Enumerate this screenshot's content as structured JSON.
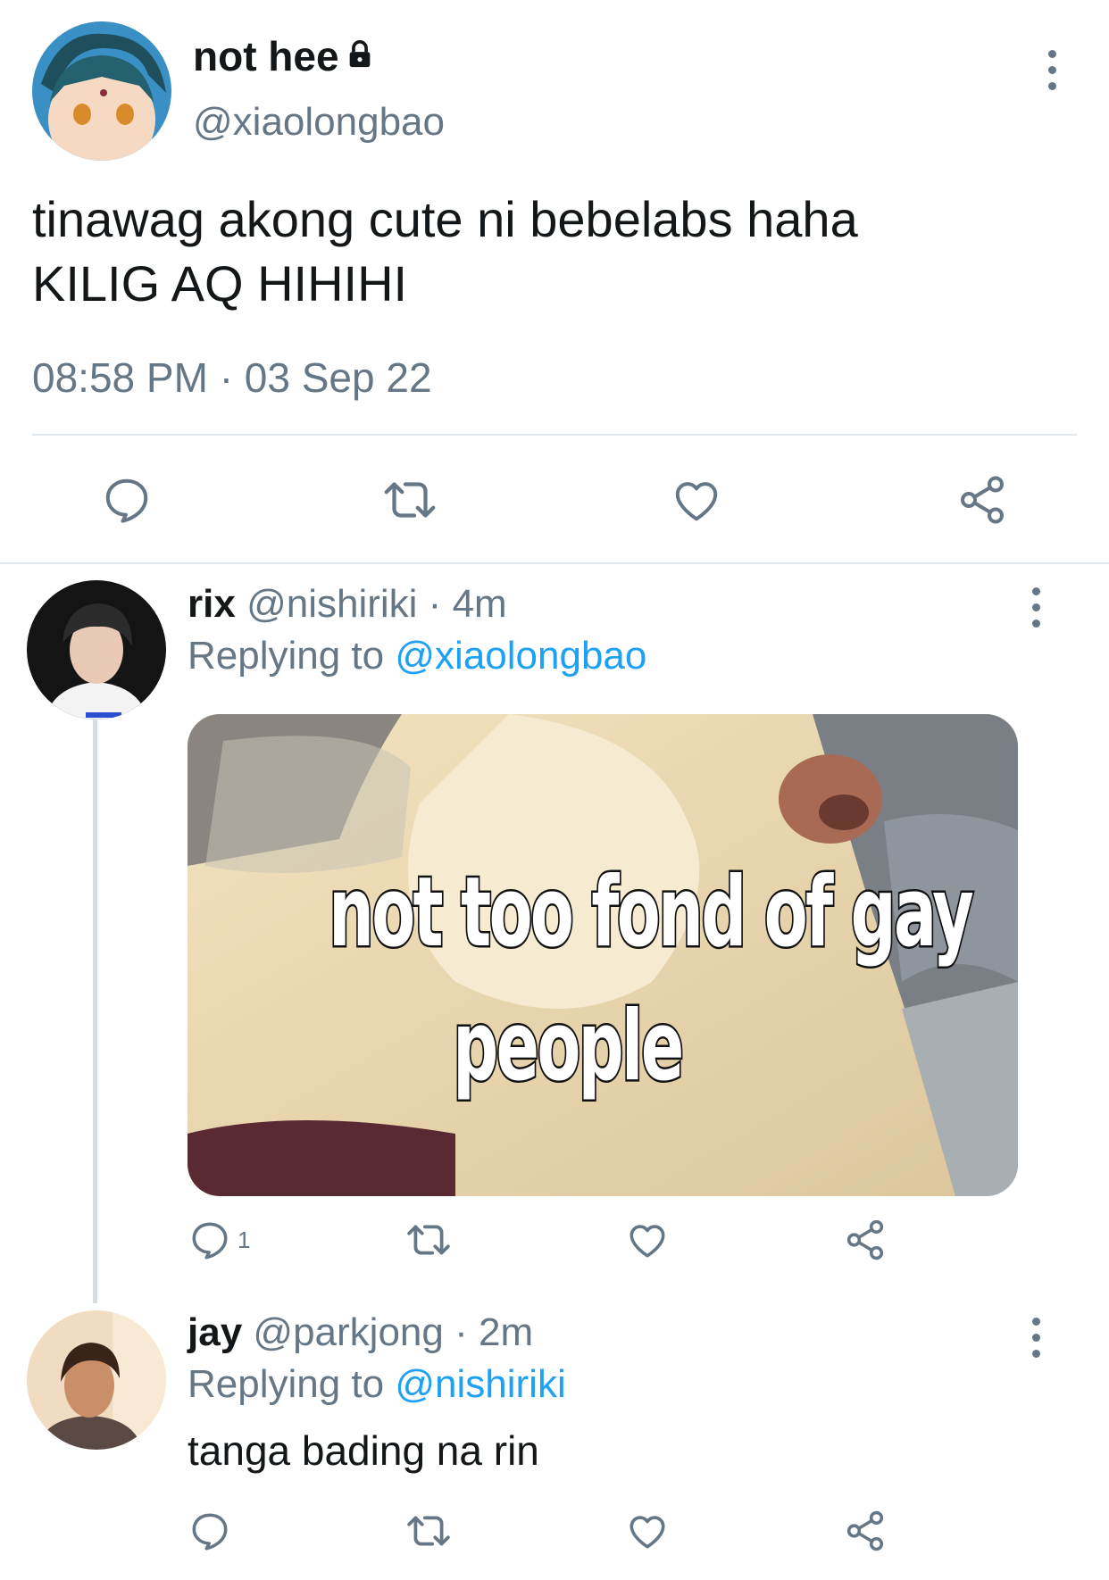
{
  "main_tweet": {
    "display_name": "not hee",
    "handle": "@xiaolongbao",
    "text_line1": "tinawag akong cute ni bebelabs haha",
    "text_line2": "KILIG AQ HIHIHI",
    "time": "08:58 PM",
    "separator": "·",
    "date": "03 Sep 22"
  },
  "reply1": {
    "display_name": "rix",
    "handle": "@nishiriki",
    "separator": "·",
    "age": "4m",
    "replying_prefix": "Replying to",
    "replying_to": "@xiaolongbao",
    "meme_line1": "not too fond of gay",
    "meme_line2": "people",
    "reply_count": "1"
  },
  "reply2": {
    "display_name": "jay",
    "handle": "@parkjong",
    "separator": "·",
    "age": "2m",
    "replying_prefix": "Replying to",
    "replying_to": "@nishiriki",
    "text": "tanga bading na rin"
  },
  "icons": [
    "lock-icon",
    "more-icon",
    "reply-icon",
    "retweet-icon",
    "like-icon",
    "share-icon"
  ],
  "colors": {
    "link": "#1da1f2",
    "muted": "#657786",
    "text": "#14171a",
    "divider": "#e1e8ed"
  }
}
